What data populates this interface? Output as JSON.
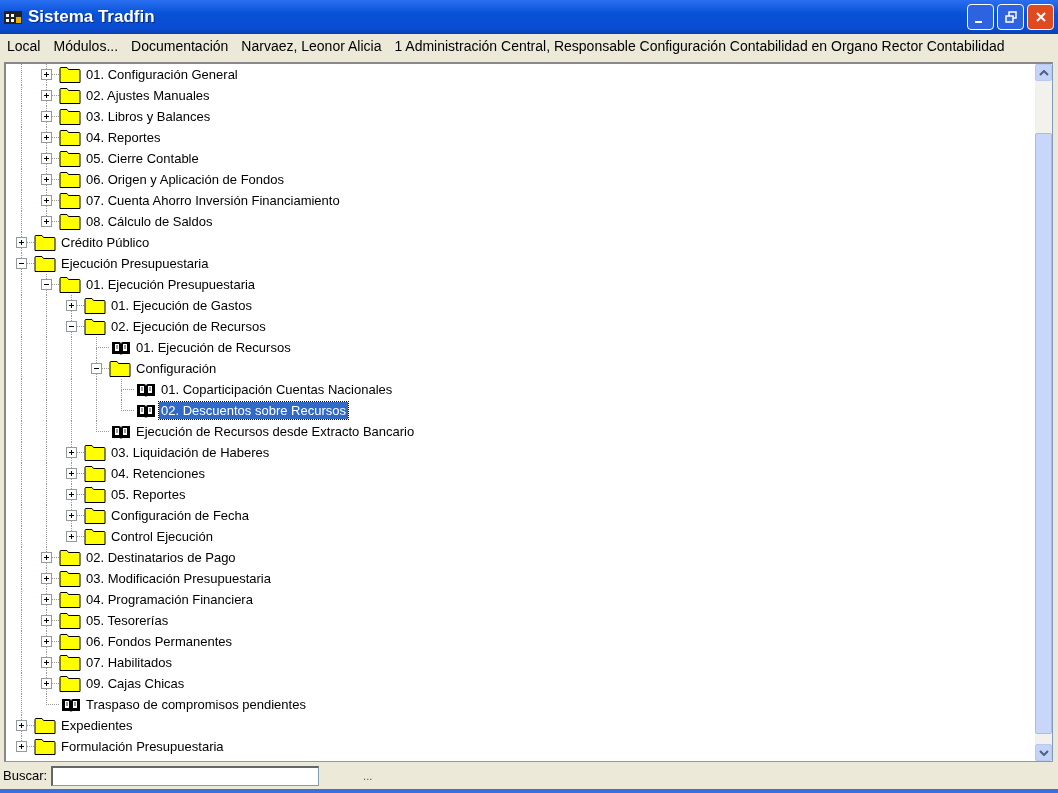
{
  "window": {
    "title": "Sistema Tradfin"
  },
  "menu": [
    "Local",
    "Módulos...",
    "Documentación",
    "Narvaez, Leonor Alicia",
    "1 Administración Central, Responsable Configuración Contabilidad en Organo Rector Contabilidad"
  ],
  "tree": [
    {
      "kind": "hidden-parent",
      "children": [
        {
          "label": "01. Configuración General",
          "kind": "folder",
          "expanded": false,
          "selected": false
        },
        {
          "label": "02. Ajustes Manuales",
          "kind": "folder",
          "expanded": false,
          "selected": false
        },
        {
          "label": "03. Libros y Balances",
          "kind": "folder",
          "expanded": false,
          "selected": false
        },
        {
          "label": "04. Reportes",
          "kind": "folder",
          "expanded": false,
          "selected": false
        },
        {
          "label": "05. Cierre Contable",
          "kind": "folder",
          "expanded": false,
          "selected": false
        },
        {
          "label": "06. Origen y Aplicación de Fondos",
          "kind": "folder",
          "expanded": false,
          "selected": false
        },
        {
          "label": "07. Cuenta Ahorro Inversión Financiamiento",
          "kind": "folder",
          "expanded": false,
          "selected": false
        },
        {
          "label": "08. Cálculo de Saldos",
          "kind": "folder",
          "expanded": false,
          "selected": false
        }
      ]
    },
    {
      "label": "Crédito Público",
      "kind": "folder",
      "expanded": false,
      "selected": false
    },
    {
      "label": "Ejecución Presupuestaria",
      "kind": "folder",
      "expanded": true,
      "selected": false,
      "children": [
        {
          "label": "01. Ejecución Presupuestaria",
          "kind": "folder",
          "expanded": true,
          "selected": false,
          "children": [
            {
              "label": "01. Ejecución de Gastos",
              "kind": "folder",
              "expanded": false,
              "selected": false
            },
            {
              "label": "02. Ejecución de Recursos",
              "kind": "folder",
              "expanded": true,
              "selected": false,
              "children": [
                {
                  "label": "01. Ejecución de Recursos",
                  "kind": "document",
                  "selected": false
                },
                {
                  "label": "Configuración",
                  "kind": "folder",
                  "expanded": true,
                  "selected": false,
                  "children": [
                    {
                      "label": "01.  Coparticipación Cuentas Nacionales",
                      "kind": "document",
                      "selected": false
                    },
                    {
                      "label": "02.  Descuentos sobre Recursos",
                      "kind": "document",
                      "selected": true
                    }
                  ]
                },
                {
                  "label": "Ejecución de Recursos desde Extracto Bancario",
                  "kind": "document",
                  "selected": false
                }
              ]
            },
            {
              "label": "03. Liquidación de Haberes",
              "kind": "folder",
              "expanded": false,
              "selected": false
            },
            {
              "label": "04. Retenciones",
              "kind": "folder",
              "expanded": false,
              "selected": false
            },
            {
              "label": "05. Reportes",
              "kind": "folder",
              "expanded": false,
              "selected": false
            },
            {
              "label": "Configuración de Fecha",
              "kind": "folder",
              "expanded": false,
              "selected": false
            },
            {
              "label": "Control Ejecución",
              "kind": "folder",
              "expanded": false,
              "selected": false
            }
          ]
        },
        {
          "label": "02. Destinatarios de Pago",
          "kind": "folder",
          "expanded": false,
          "selected": false
        },
        {
          "label": "03. Modificación Presupuestaria",
          "kind": "folder",
          "expanded": false,
          "selected": false
        },
        {
          "label": "04. Programación Financiera",
          "kind": "folder",
          "expanded": false,
          "selected": false
        },
        {
          "label": "05. Tesorerías",
          "kind": "folder",
          "expanded": false,
          "selected": false
        },
        {
          "label": "06. Fondos Permanentes",
          "kind": "folder",
          "expanded": false,
          "selected": false
        },
        {
          "label": "07. Habilitados",
          "kind": "folder",
          "expanded": false,
          "selected": false
        },
        {
          "label": "09. Cajas Chicas",
          "kind": "folder",
          "expanded": false,
          "selected": false
        },
        {
          "label": "Traspaso de compromisos pendientes",
          "kind": "document",
          "selected": false
        }
      ]
    },
    {
      "label": "Expedientes",
      "kind": "folder",
      "expanded": false,
      "selected": false
    },
    {
      "label": "Formulación Presupuestaria",
      "kind": "folder",
      "expanded": false,
      "selected": false
    }
  ],
  "search": {
    "label": "Buscar:",
    "button": "..."
  }
}
